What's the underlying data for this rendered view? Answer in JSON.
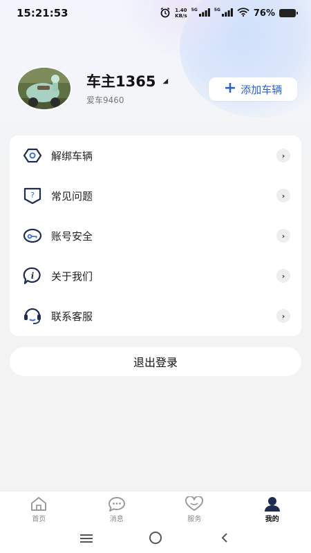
{
  "status_bar": {
    "time": "15:21:53",
    "net_speed_value": "1.40",
    "net_speed_unit": "KB/s",
    "signal1_label": "5G",
    "signal2_label": "5G",
    "battery": "76%"
  },
  "profile": {
    "name": "车主1365",
    "car": "爱车9460",
    "add_button": "添加车辆"
  },
  "menu": {
    "items": [
      {
        "label": "解绑车辆",
        "icon": "unbind-icon"
      },
      {
        "label": "常见问题",
        "icon": "faq-icon"
      },
      {
        "label": "账号安全",
        "icon": "account-security-icon"
      },
      {
        "label": "关于我们",
        "icon": "about-icon"
      },
      {
        "label": "联系客服",
        "icon": "customer-service-icon"
      }
    ]
  },
  "logout_label": "退出登录",
  "tabs": [
    {
      "label": "首页",
      "icon": "home-icon",
      "active": false
    },
    {
      "label": "消息",
      "icon": "message-icon",
      "active": false
    },
    {
      "label": "服务",
      "icon": "heart-icon",
      "active": false
    },
    {
      "label": "我的",
      "icon": "profile-icon",
      "active": true
    }
  ],
  "colors": {
    "accent": "#2f5fc4",
    "icon_navy": "#1e2d4f"
  }
}
